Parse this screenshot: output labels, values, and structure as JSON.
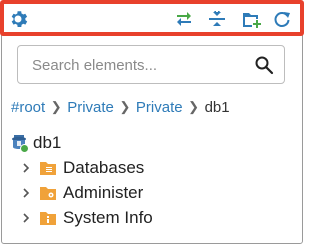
{
  "toolbar": {
    "icons": [
      "gear-icon",
      "swap-arrows-icon",
      "collapse-icon",
      "new-folder-icon",
      "refresh-icon"
    ],
    "accent": "#2e7bb8",
    "green": "#49a847",
    "highlight_border": "#e8412c"
  },
  "search": {
    "placeholder": "Search elements...",
    "value": ""
  },
  "breadcrumb": {
    "items": [
      "#root",
      "Private",
      "Private",
      "db1"
    ]
  },
  "tree": {
    "root_label": "db1",
    "items": [
      {
        "label": "Databases",
        "icon": "database-folder-icon"
      },
      {
        "label": "Administer",
        "icon": "admin-folder-icon"
      },
      {
        "label": "System Info",
        "icon": "info-folder-icon"
      }
    ],
    "folder_color": "#f0a23a"
  }
}
